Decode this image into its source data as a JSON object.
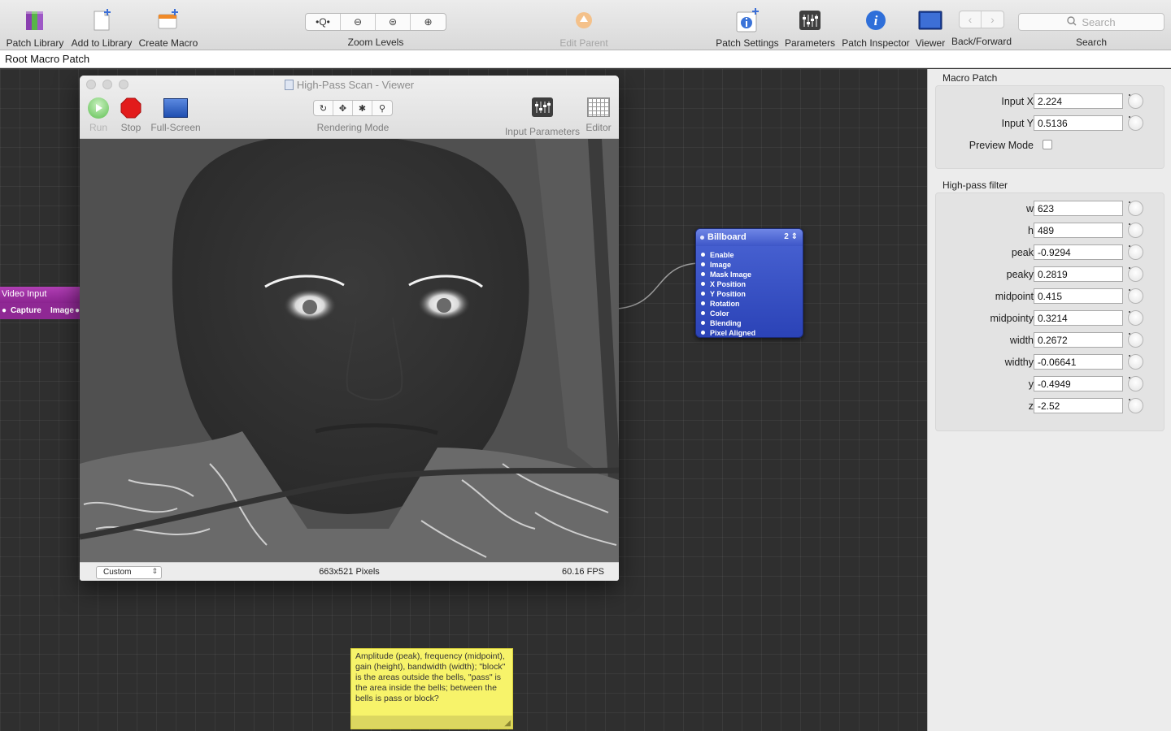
{
  "toolbar": {
    "patch_library": "Patch Library",
    "add_to_library": "Add to Library",
    "create_macro": "Create Macro",
    "zoom_levels": "Zoom Levels",
    "edit_parent": "Edit Parent",
    "patch_settings": "Patch Settings",
    "parameters": "Parameters",
    "patch_inspector": "Patch Inspector",
    "viewer": "Viewer",
    "back_forward": "Back/Forward",
    "search_label": "Search",
    "search_placeholder": "Search"
  },
  "breadcrumb": "Root Macro Patch",
  "viewer_window": {
    "title": "High-Pass Scan - Viewer",
    "run": "Run",
    "stop": "Stop",
    "full_screen": "Full-Screen",
    "rendering_mode": "Rendering Mode",
    "input_parameters": "Input Parameters",
    "editor": "Editor",
    "mode_select": "Custom",
    "pixel_size": "663x521 Pixels",
    "fps": "60.16 FPS"
  },
  "patches": {
    "video_input": {
      "title": "Video Input",
      "port_in": "Capture",
      "port_out": "Image"
    },
    "billboard": {
      "title": "Billboard",
      "count": "2",
      "ports": [
        "Enable",
        "Image",
        "Mask Image",
        "X Position",
        "Y Position",
        "Rotation",
        "Color",
        "Blending",
        "Pixel Aligned"
      ]
    }
  },
  "note": {
    "text": "Amplitude (peak), frequency (midpoint), gain (height), bandwidth (width); \"block\" is the areas outside the bells, \"pass\" is the area inside the bells; between the bells is pass or block?"
  },
  "panel": {
    "macro_title": "Macro Patch",
    "macro_params": [
      {
        "label": "Input X",
        "value": "2.224"
      },
      {
        "label": "Input Y",
        "value": "0.5136"
      }
    ],
    "preview_mode": {
      "label": "Preview Mode",
      "checked": false
    },
    "filter_title": "High-pass filter",
    "filter_params": [
      {
        "label": "w",
        "value": "623"
      },
      {
        "label": "h",
        "value": "489"
      },
      {
        "label": "peak",
        "value": "-0.9294"
      },
      {
        "label": "peaky",
        "value": "0.2819"
      },
      {
        "label": "midpoint",
        "value": "0.415"
      },
      {
        "label": "midpointy",
        "value": "0.3214"
      },
      {
        "label": "width",
        "value": "0.2672"
      },
      {
        "label": "widthy",
        "value": "-0.06641"
      },
      {
        "label": "y",
        "value": "-0.4949"
      },
      {
        "label": "z",
        "value": "-2.52"
      }
    ]
  },
  "colors": {
    "billboard": "#3049c2",
    "video_input": "#9a2ea0",
    "note": "#f7f36a",
    "stop": "#e21b1b",
    "canvas": "#2f2f2f"
  }
}
